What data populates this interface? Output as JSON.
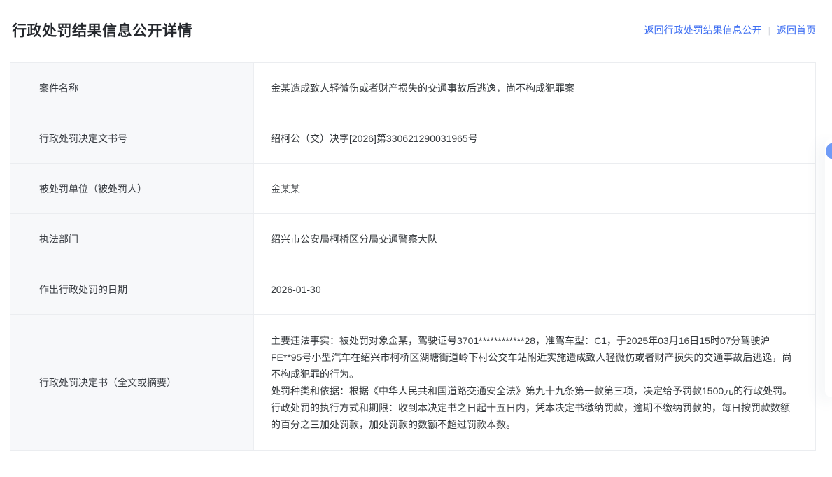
{
  "header": {
    "title": "行政处罚结果信息公开详情",
    "links": [
      {
        "label": "返回行政处罚结果信息公开"
      },
      {
        "label": "返回首页"
      }
    ],
    "divider": "|",
    "link_color": "#3D6EF2"
  },
  "table": {
    "label_bg_color": "#f7f8fa",
    "border_color": "#ebedf0",
    "rows": [
      {
        "label": "案件名称",
        "value": "金某造成致人轻微伤或者财产损失的交通事故后逃逸，尚不构成犯罪案"
      },
      {
        "label": "行政处罚决定文书号",
        "value": "绍柯公（交）决字[2026]第330621290031965号"
      },
      {
        "label": "被处罚单位（被处罚人）",
        "value": "金某某"
      },
      {
        "label": "执法部门",
        "value": "绍兴市公安局柯桥区分局交通警察大队"
      },
      {
        "label": "作出行政处罚的日期",
        "value": "2026-01-30"
      },
      {
        "label": "行政处罚决定书（全文或摘要）",
        "paragraphs": [
          "主要违法事实：被处罚对象金某，驾驶证号3701************28，准驾车型：C1，于2025年03月16日15时07分驾驶沪FE**95号小型汽车在绍兴市柯桥区湖塘街道岭下村公交车站附近实施造成致人轻微伤或者财产损失的交通事故后逃逸，尚不构成犯罪的行为。",
          "处罚种类和依据：根据《中华人民共和国道路交通安全法》第九十九条第一款第三项，决定给予罚款1500元的行政处罚。",
          "行政处罚的执行方式和期限：收到本决定书之日起十五日内，凭本决定书缴纳罚款，逾期不缴纳罚款的，每日按罚款数额的百分之三加处罚款，加处罚款的数额不超过罚款本数。"
        ]
      }
    ]
  }
}
